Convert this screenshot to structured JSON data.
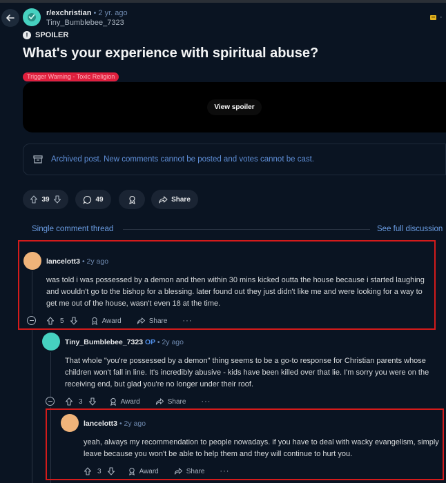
{
  "header": {
    "subreddit": "r/exchristian",
    "post_age": "• 2 yr. ago",
    "author": "Tiny_Bumblebee_7323"
  },
  "post": {
    "spoiler_label": "SPOILER",
    "title": "What's your experience with spiritual abuse?",
    "flair": "Trigger Warning - Toxic Religion",
    "view_spoiler": "View spoiler",
    "archived_notice": "Archived post. New comments cannot be posted and votes cannot be cast.",
    "votes": "39",
    "comments": "49",
    "share": "Share"
  },
  "thread": {
    "single_label": "Single comment thread",
    "full_label": "See full discussion"
  },
  "comments": [
    {
      "author": "lancelott3",
      "time": "• 2y ago",
      "op_badge": "",
      "body": "was told i was possessed by a demon and then within 30 mins kicked outta the house because i started laughing and wouldn't go to the bishop for a blessing. later found out they just didn't like me and were looking for a way to get me out of the house, wasn't even 18 at the time.",
      "votes": "5",
      "award": "Award",
      "share": "Share",
      "more": "···"
    },
    {
      "author": "Tiny_Bumblebee_7323",
      "time": "• 2y ago",
      "op_badge": "OP",
      "body": "That whole \"you're possessed by a demon\" thing seems to be a go-to response for Christian parents whose children won't fall in line. It's incredibly abusive - kids have been killed over that lie. I'm sorry you were on the receiving end, but glad you're no longer under their roof.",
      "votes": "3",
      "award": "Award",
      "share": "Share",
      "more": "···"
    },
    {
      "author": "lancelott3",
      "time": "• 2y ago",
      "op_badge": "",
      "body": "yeah, always my recommendation to people nowadays. if you have to deal with wacky evangelism, simply leave because you won't be able to help them and they will continue to hurt you.",
      "votes": "3",
      "award": "Award",
      "share": "Share",
      "more": "···"
    }
  ],
  "colors": {
    "background": "#0a1422",
    "accent_link": "#6b9ee5",
    "flair_red": "#e01f3d",
    "highlight_border": "#d41b1b",
    "pill_bg": "#1a2433"
  },
  "icons": [
    "back-arrow-icon",
    "subreddit-avatar-icon",
    "spoiler-icon",
    "archive-icon",
    "upvote-icon",
    "downvote-icon",
    "comment-icon",
    "award-icon",
    "share-icon",
    "collapse-icon",
    "more-icon"
  ]
}
